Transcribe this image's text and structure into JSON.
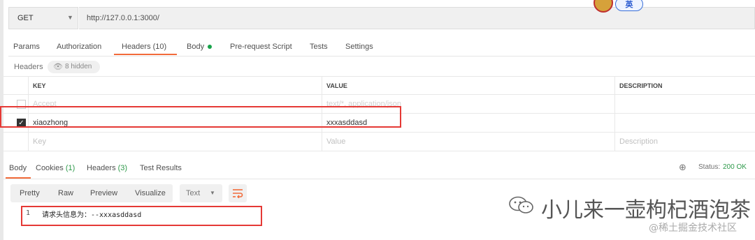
{
  "request": {
    "method": "GET",
    "url": "http://127.0.0.1:3000/",
    "ime_label": "英"
  },
  "request_tabs": [
    {
      "label": "Params"
    },
    {
      "label": "Authorization"
    },
    {
      "label": "Headers (10)",
      "active": true
    },
    {
      "label": "Body"
    },
    {
      "label": "Pre-request Script"
    },
    {
      "label": "Tests"
    },
    {
      "label": "Settings"
    }
  ],
  "headers_section": {
    "title": "Headers",
    "hidden_label": "8 hidden"
  },
  "table": {
    "columns": [
      "KEY",
      "VALUE",
      "DESCRIPTION"
    ],
    "rows": [
      {
        "key": "Accept",
        "value": "text/*, application/json",
        "description": "",
        "checked": false,
        "faded": true
      },
      {
        "key": "xiaozhong",
        "value": "xxxasddasd",
        "description": "",
        "checked": true,
        "faded": false
      }
    ],
    "placeholders": {
      "key": "Key",
      "value": "Value",
      "description": "Description"
    }
  },
  "response_tabs": [
    {
      "label": "Body",
      "active": true
    },
    {
      "label": "Cookies",
      "count": "(1)"
    },
    {
      "label": "Headers",
      "count": "(3)"
    },
    {
      "label": "Test Results"
    }
  ],
  "status": {
    "label": "Status:",
    "value": "200 OK"
  },
  "view_modes": [
    "Pretty",
    "Raw",
    "Preview",
    "Visualize"
  ],
  "format_select": "Text",
  "response_body": [
    {
      "line": "1",
      "text": "请求头信息为：--xxxasddasd"
    }
  ],
  "watermark": {
    "title": "小儿来一壶枸杞酒泡茶",
    "subtitle": "@稀土掘金技术社区"
  },
  "colors": {
    "accent": "#f26b3a",
    "status_ok": "#2f9a4b",
    "annotation_red": "#e53935",
    "body_dot": "#17a34a"
  }
}
